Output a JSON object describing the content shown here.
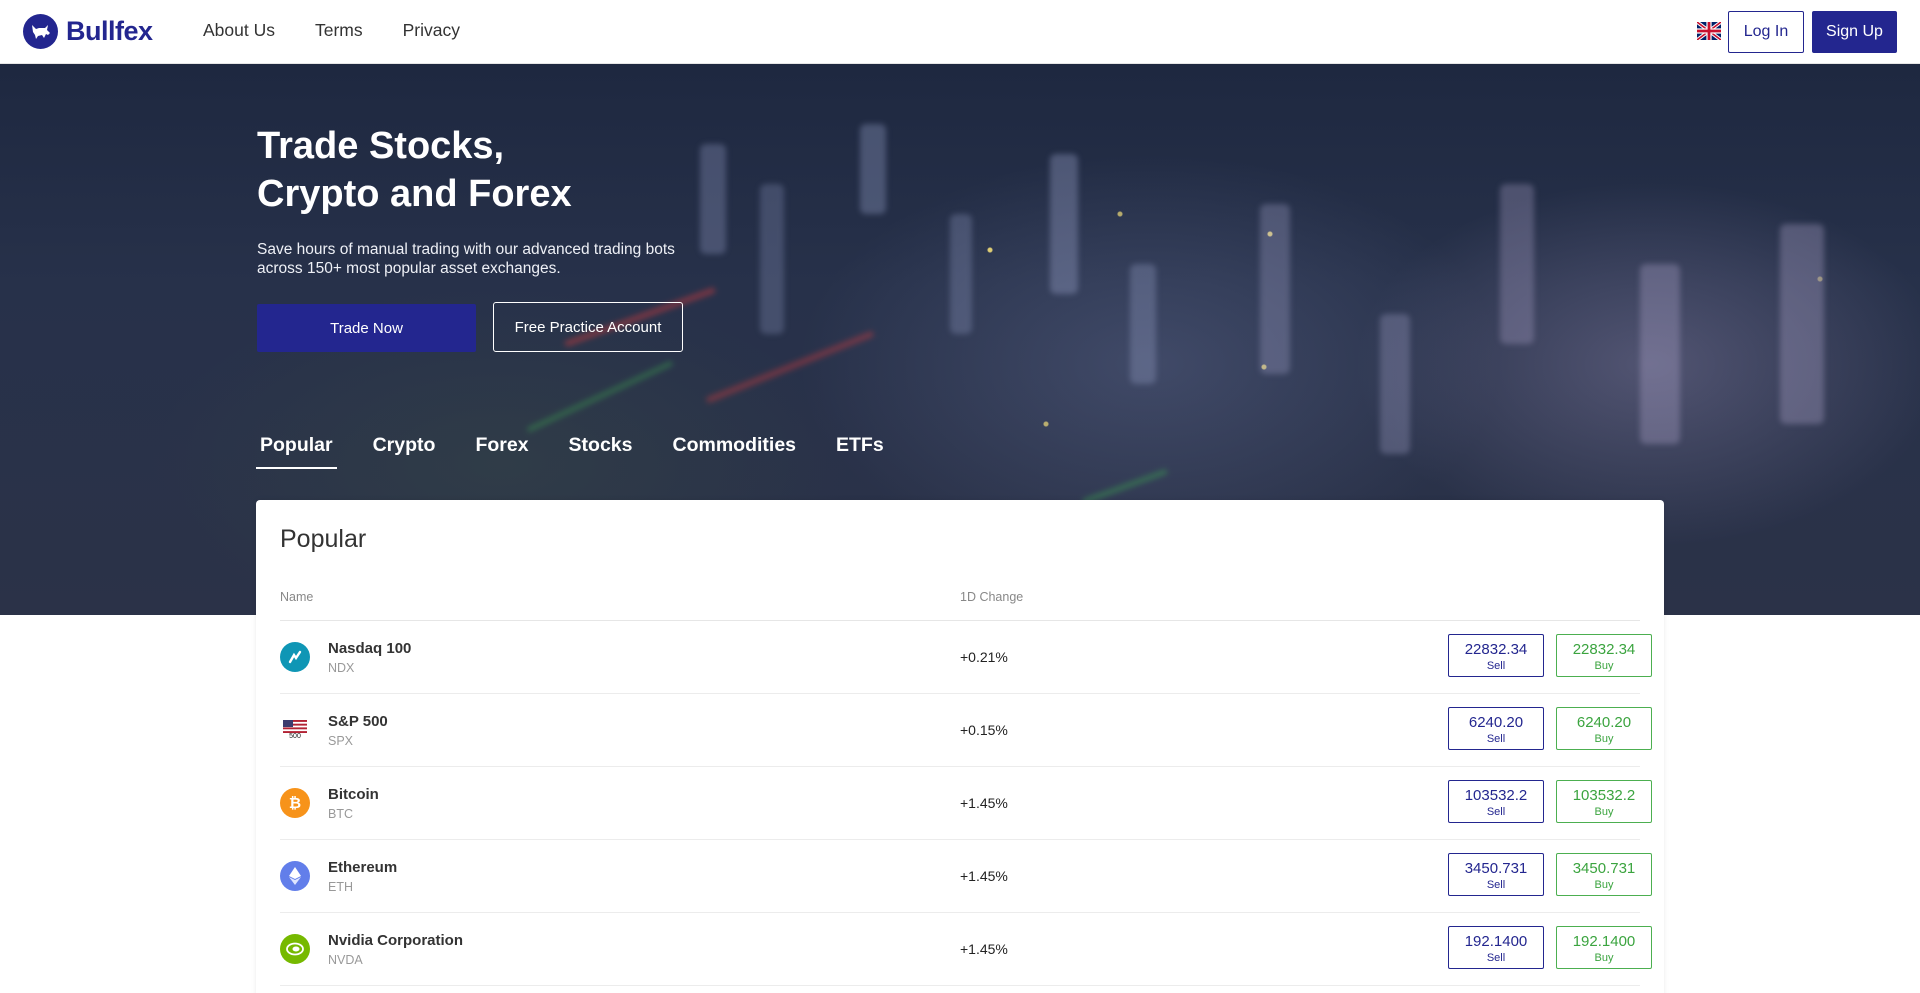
{
  "header": {
    "brand": "Bullfex",
    "nav": [
      "About Us",
      "Terms",
      "Privacy"
    ],
    "login_label": "Log In",
    "signup_label": "Sign Up"
  },
  "hero": {
    "title_line1": "Trade Stocks,",
    "title_line2": "Crypto and Forex",
    "subtitle_line1": "Save hours of manual trading with our advanced trading bots",
    "subtitle_line2": "across 150+ most popular asset exchanges.",
    "trade_now_label": "Trade Now",
    "practice_label": "Free Practice Account"
  },
  "tabs": [
    "Popular",
    "Crypto",
    "Forex",
    "Stocks",
    "Commodities",
    "ETFs"
  ],
  "active_tab": "Popular",
  "table": {
    "title": "Popular",
    "col_name": "Name",
    "col_change": "1D Change",
    "sell_label": "Sell",
    "buy_label": "Buy",
    "rows": [
      {
        "name": "Nasdaq 100",
        "symbol": "NDX",
        "change": "+0.21%",
        "sell": "22832.34",
        "buy": "22832.34",
        "icon": "nasdaq-icon",
        "color": "#0f96b5"
      },
      {
        "name": "S&P 500",
        "symbol": "SPX",
        "change": "+0.15%",
        "sell": "6240.20",
        "buy": "6240.20",
        "icon": "us-flag-500-icon",
        "color": "#ffffff",
        "icon_label": "500"
      },
      {
        "name": "Bitcoin",
        "symbol": "BTC",
        "change": "+1.45%",
        "sell": "103532.2",
        "buy": "103532.2",
        "icon": "bitcoin-icon",
        "color": "#f7931a"
      },
      {
        "name": "Ethereum",
        "symbol": "ETH",
        "change": "+1.45%",
        "sell": "3450.731",
        "buy": "3450.731",
        "icon": "ethereum-icon",
        "color": "#627eea"
      },
      {
        "name": "Nvidia Corporation",
        "symbol": "NVDA",
        "change": "+1.45%",
        "sell": "192.1400",
        "buy": "192.1400",
        "icon": "nvidia-icon",
        "color": "#76b900"
      }
    ]
  },
  "colors": {
    "brand": "#23268f",
    "buy": "#3ba43f"
  }
}
